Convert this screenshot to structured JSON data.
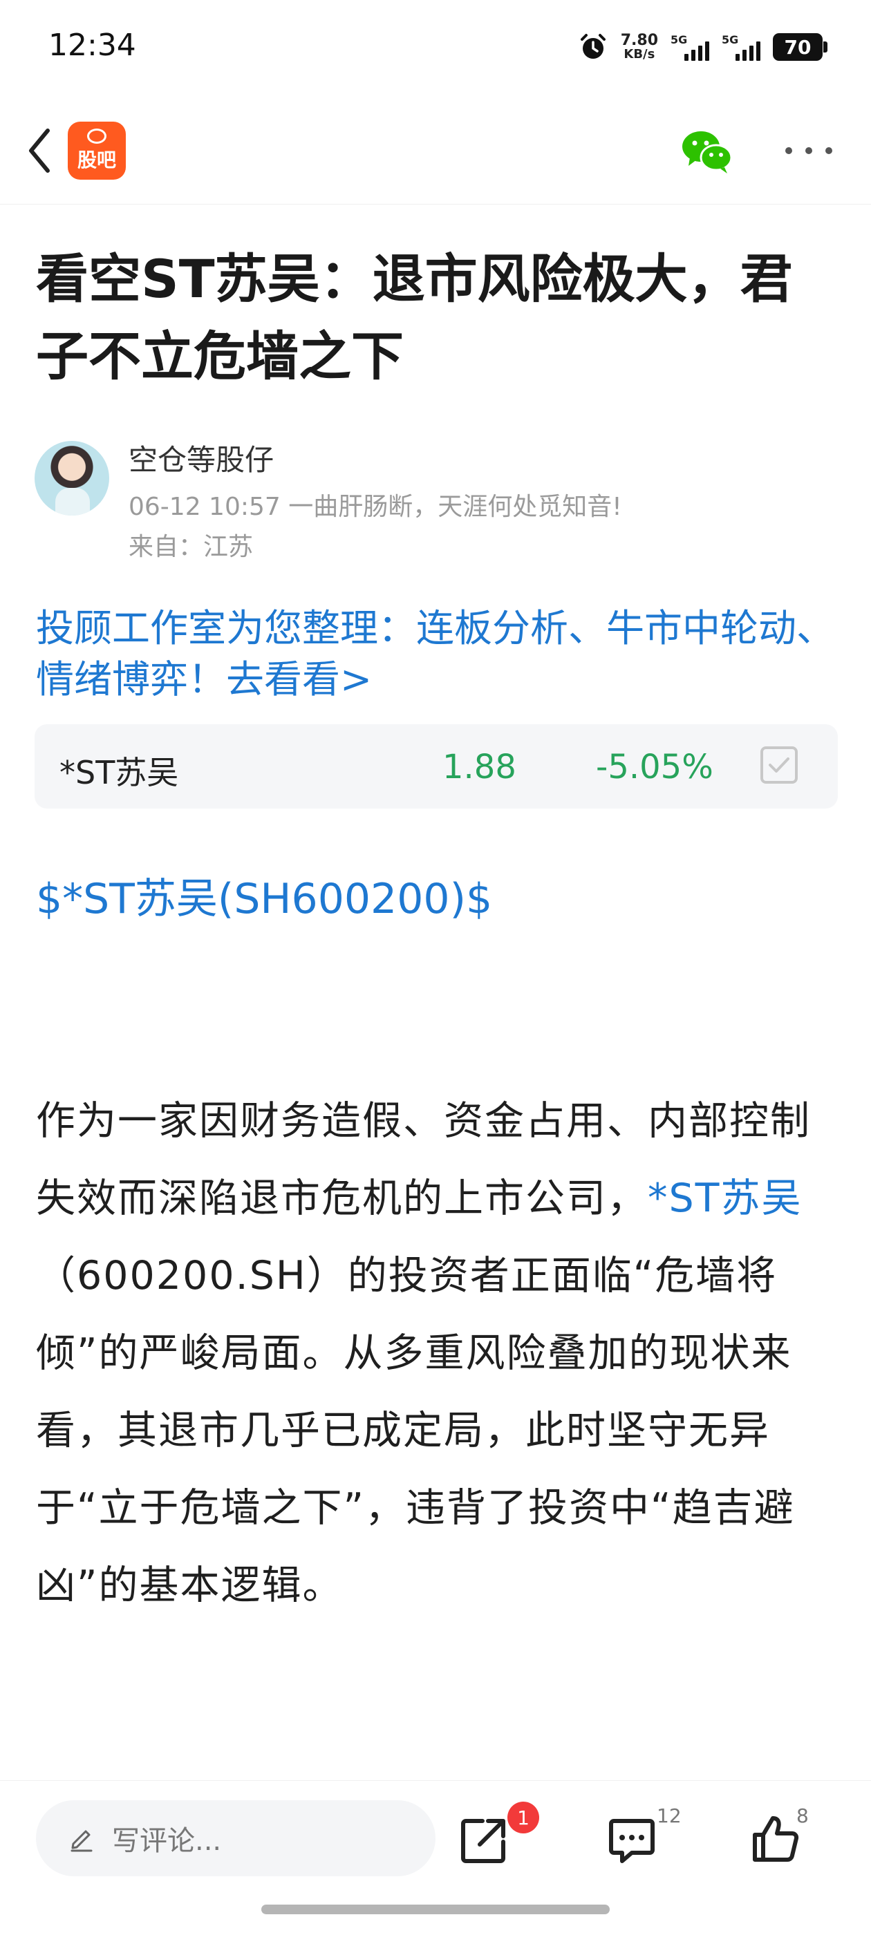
{
  "status_bar": {
    "time": "12:34",
    "net_speed_value": "7.80",
    "net_speed_unit": "KB/s",
    "signal1_tag": "5G",
    "signal2_tag": "5G",
    "battery": "70"
  },
  "nav": {
    "app_name": "股吧",
    "icons": [
      "back-icon",
      "app-logo",
      "wechat-icon",
      "more-icon"
    ]
  },
  "article": {
    "title": "看空ST苏吴：退市风险极大，君子不立危墙之下",
    "author": "空仓等股仔",
    "datetime": "06-12 10:57",
    "signature": "一曲肝肠断，天涯何处觅知音!",
    "location": "来自：江苏",
    "promo_link": "投顾工作室为您整理：连板分析、牛市中轮动、情绪博弈！去看看>",
    "ticker_link": "$*ST苏吴(SH600200)$",
    "body_part1": "作为一家因财务造假、资金占用、内部控制失效而深陷退市危机的上市公司，",
    "body_link": "*ST苏吴",
    "body_part2": "（600200.SH）的投资者正面临“危墙将倾”的严峻局面。从多重风险叠加的现状来看，其退市几乎已成定局，此时坚守无异于“立于危墙之下”，违背了投资中“趋吉避凶”的基本逻辑。"
  },
  "stock_card": {
    "name": "*ST苏吴",
    "price": "1.88",
    "change": "-5.05%",
    "change_color": "#27a35b"
  },
  "bottom_bar": {
    "comment_placeholder": "写评论...",
    "share_badge": "1",
    "comment_count": "12",
    "like_count": "8"
  },
  "colors": {
    "link": "#1e78d1",
    "brand": "#ff5a1f",
    "wechat": "#2dc100"
  }
}
